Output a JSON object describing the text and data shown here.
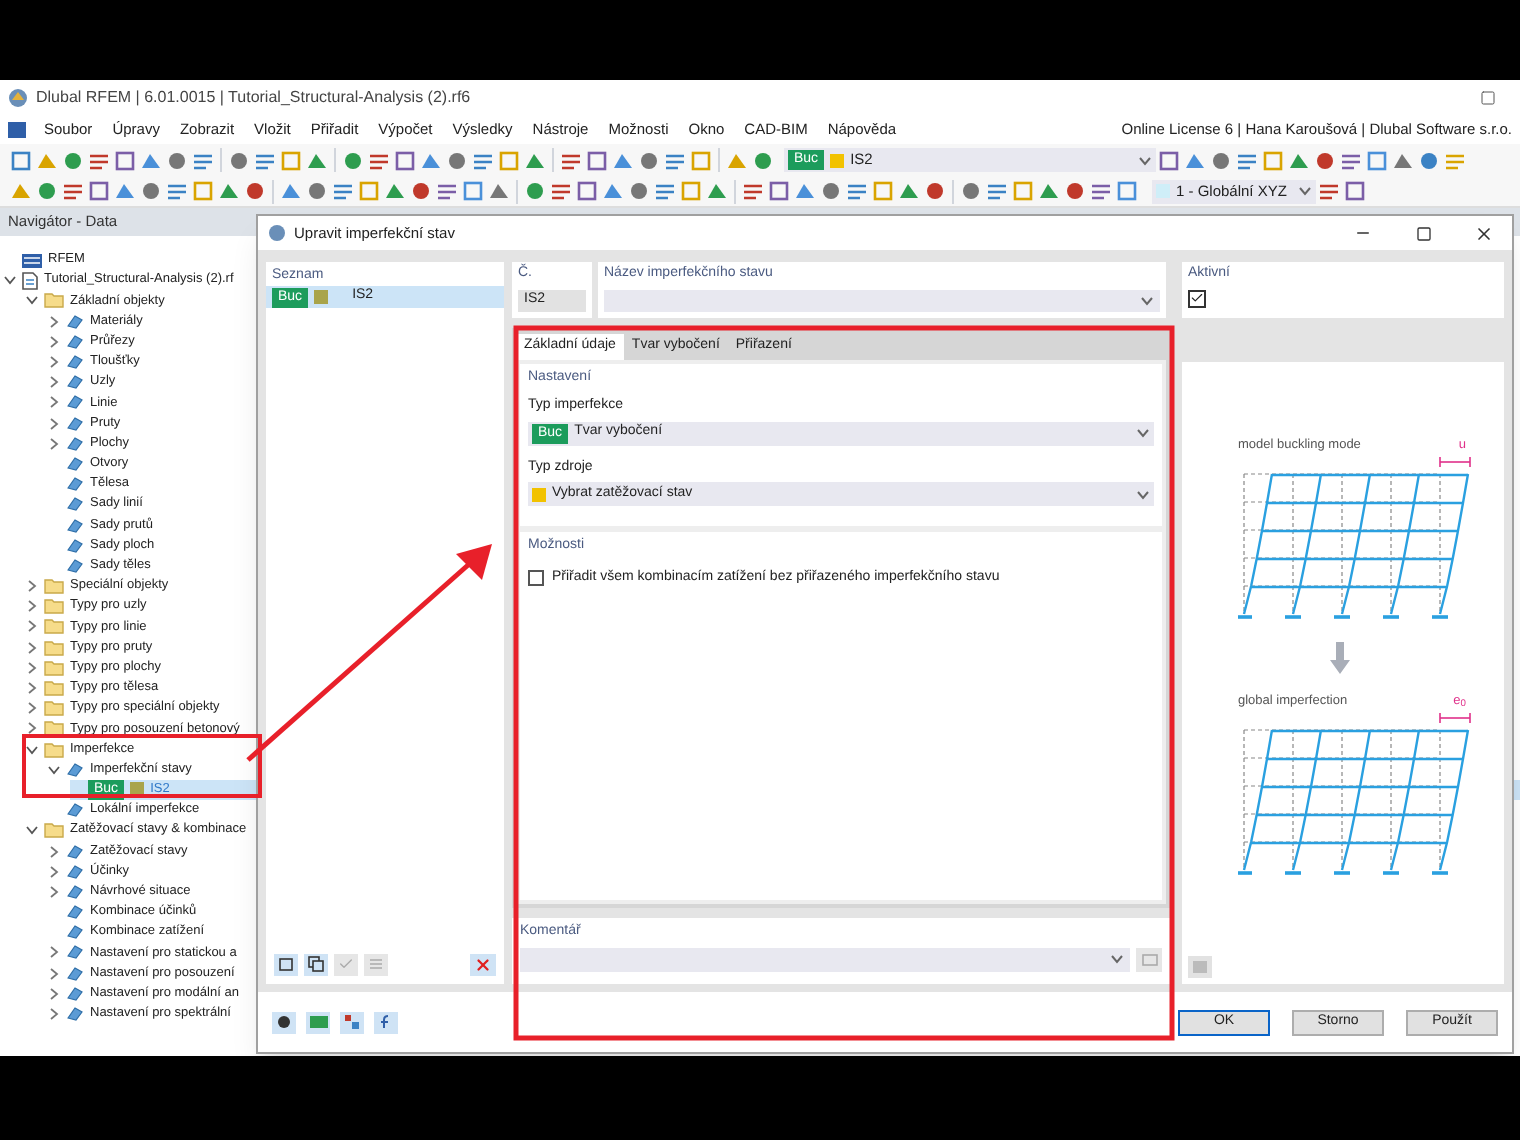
{
  "app": {
    "title": "Dlubal RFEM | 6.01.0015 | Tutorial_Structural-Analysis (2).rf6"
  },
  "menu": [
    "Soubor",
    "Úpravy",
    "Zobrazit",
    "Vložit",
    "Přiřadit",
    "Výpočet",
    "Výsledky",
    "Nástroje",
    "Možnosti",
    "Okno",
    "CAD-BIM",
    "Nápověda"
  ],
  "license": "Online License 6 | Hana Karoušová | Dlubal Software s.r.o.",
  "toolbar_case": {
    "badge": "Buc",
    "value": "IS2"
  },
  "toolbar_view": {
    "value": "1 - Globální XYZ"
  },
  "navigator": {
    "title": "Navigátor - Data",
    "tree": [
      {
        "label": "RFEM",
        "kind": "root",
        "selected": false
      },
      {
        "label": "Tutorial_Structural-Analysis (2).rf",
        "kind": "file",
        "expanded": true,
        "selected": false,
        "children": [
          {
            "label": "Základní objekty",
            "kind": "folder",
            "expanded": true,
            "selected": false,
            "children": [
              {
                "label": "Materiály",
                "kind": "item",
                "expanded": false,
                "selected": false
              },
              {
                "label": "Průřezy",
                "kind": "item",
                "expanded": false,
                "selected": false
              },
              {
                "label": "Tloušťky",
                "kind": "item",
                "expanded": false,
                "selected": false
              },
              {
                "label": "Uzly",
                "kind": "item",
                "expanded": false,
                "selected": false
              },
              {
                "label": "Linie",
                "kind": "item",
                "expanded": false,
                "selected": false
              },
              {
                "label": "Pruty",
                "kind": "item",
                "expanded": false,
                "selected": false
              },
              {
                "label": "Plochy",
                "kind": "item",
                "expanded": false,
                "selected": false
              },
              {
                "label": "Otvory",
                "kind": "item",
                "selected": false
              },
              {
                "label": "Tělesa",
                "kind": "item",
                "selected": false
              },
              {
                "label": "Sady linií",
                "kind": "item",
                "selected": false
              },
              {
                "label": "Sady prutů",
                "kind": "item",
                "selected": false
              },
              {
                "label": "Sady ploch",
                "kind": "item",
                "selected": false
              },
              {
                "label": "Sady těles",
                "kind": "item",
                "selected": false
              }
            ]
          },
          {
            "label": "Speciální objekty",
            "kind": "folder",
            "expanded": false,
            "selected": false
          },
          {
            "label": "Typy pro uzly",
            "kind": "folder",
            "expanded": false,
            "selected": false
          },
          {
            "label": "Typy pro linie",
            "kind": "folder",
            "expanded": false,
            "selected": false
          },
          {
            "label": "Typy pro pruty",
            "kind": "folder",
            "expanded": false,
            "selected": false
          },
          {
            "label": "Typy pro plochy",
            "kind": "folder",
            "expanded": false,
            "selected": false
          },
          {
            "label": "Typy pro tělesa",
            "kind": "folder",
            "expanded": false,
            "selected": false
          },
          {
            "label": "Typy pro speciální objekty",
            "kind": "folder",
            "expanded": false,
            "selected": false
          },
          {
            "label": "Typy pro posouzení betonový",
            "kind": "folder",
            "expanded": false,
            "selected": false
          },
          {
            "label": "Imperfekce",
            "kind": "folder",
            "expanded": true,
            "selected": false,
            "children": [
              {
                "label": "Imperfekční stavy",
                "kind": "item",
                "expanded": true,
                "selected": false,
                "children": [
                  {
                    "label": "IS2",
                    "badge": "Buc",
                    "kind": "case",
                    "selected": true
                  }
                ]
              },
              {
                "label": "Lokální imperfekce",
                "kind": "item",
                "selected": false
              }
            ]
          },
          {
            "label": "Zatěžovací stavy & kombinace",
            "kind": "folder",
            "expanded": true,
            "selected": false,
            "children": [
              {
                "label": "Zatěžovací stavy",
                "kind": "item",
                "expanded": false,
                "selected": false
              },
              {
                "label": "Účinky",
                "kind": "item",
                "expanded": false,
                "selected": false
              },
              {
                "label": "Návrhové situace",
                "kind": "item",
                "expanded": false,
                "selected": false
              },
              {
                "label": "Kombinace účinků",
                "kind": "item",
                "selected": false
              },
              {
                "label": "Kombinace zatížení",
                "kind": "item",
                "selected": false
              },
              {
                "label": "Nastavení pro statickou a",
                "kind": "item",
                "expanded": false,
                "selected": false
              },
              {
                "label": "Nastavení pro posouzení",
                "kind": "item",
                "expanded": false,
                "selected": false
              },
              {
                "label": "Nastavení pro modální an",
                "kind": "item",
                "expanded": false,
                "selected": false
              },
              {
                "label": "Nastavení pro spektrální",
                "kind": "item",
                "expanded": false,
                "selected": false
              }
            ]
          }
        ]
      }
    ]
  },
  "dialog": {
    "title": "Upravit imperfekční stav",
    "list": {
      "title": "Seznam",
      "items": [
        {
          "badge": "Buc",
          "label": "IS2",
          "selected": true
        }
      ]
    },
    "number": {
      "label": "Č.",
      "value": "IS2"
    },
    "name": {
      "label": "Název imperfekčního stavu"
    },
    "active": {
      "label": "Aktivní",
      "checked": true
    },
    "tabs": [
      {
        "label": "Základní údaje",
        "selected": true
      },
      {
        "label": "Tvar vybočení",
        "selected": false
      },
      {
        "label": "Přiřazení",
        "selected": false
      }
    ],
    "settings": {
      "title": "Nastavení",
      "fields": [
        {
          "label": "Typ imperfekce",
          "kind": "badge",
          "badge": "Buc",
          "value": "Tvar vybočení"
        },
        {
          "label": "Typ zdroje",
          "kind": "swatch",
          "value": "Vybrat zatěžovací stav"
        }
      ]
    },
    "options": {
      "title": "Možnosti",
      "items": [
        {
          "label": "Přiřadit všem kombinacím zatížení bez přiřazeného imperfekčního stavu",
          "checked": false
        }
      ]
    },
    "comment": {
      "label": "Komentář"
    },
    "figure": {
      "top_label": "model buckling mode",
      "top_mark": "u",
      "bottom_label": "global imperfection",
      "bottom_mark": "e$_{0}$"
    },
    "buttons": [
      {
        "label": "OK",
        "default": true
      },
      {
        "label": "Storno",
        "default": false
      },
      {
        "label": "Použít",
        "default": false
      }
    ]
  }
}
